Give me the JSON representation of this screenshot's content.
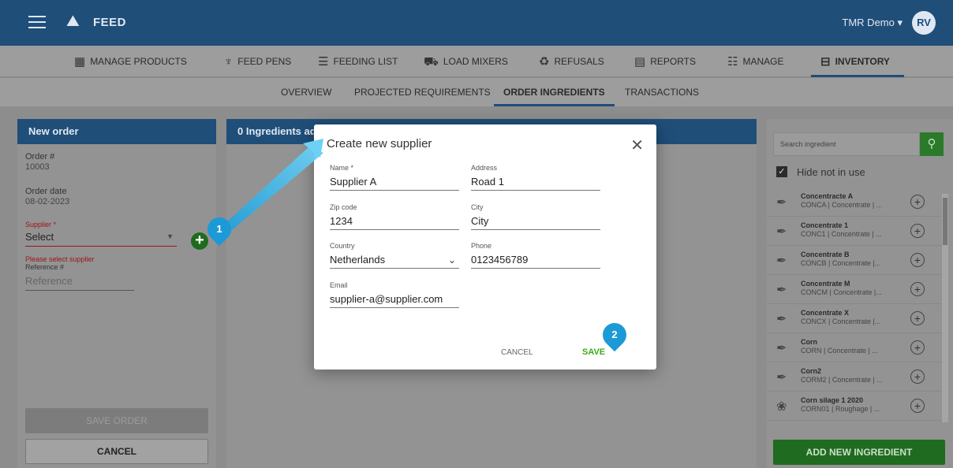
{
  "topbar": {
    "app_name": "FEED",
    "user_menu": "TMR Demo ▾",
    "avatar": "RV",
    "menu_icon": "hamburger-icon",
    "logo_icon": "cow-icon"
  },
  "modules": [
    {
      "label": "MANAGE PRODUCTS",
      "icon": "products-icon",
      "glyph": "▦"
    },
    {
      "label": "FEED PENS",
      "icon": "pen-icon",
      "glyph": "♆"
    },
    {
      "label": "FEEDING LIST",
      "icon": "list-icon",
      "glyph": "☰"
    },
    {
      "label": "LOAD MIXERS",
      "icon": "truck-icon",
      "glyph": "⛟"
    },
    {
      "label": "REFUSALS",
      "icon": "recycle-icon",
      "glyph": "♻"
    },
    {
      "label": "REPORTS",
      "icon": "reports-icon",
      "glyph": "▤"
    },
    {
      "label": "MANAGE",
      "icon": "manage-icon",
      "glyph": "☷"
    },
    {
      "label": "INVENTORY",
      "icon": "inventory-icon",
      "glyph": "⊟"
    }
  ],
  "tabs": [
    "OVERVIEW",
    "PROJECTED REQUIREMENTS",
    "ORDER INGREDIENTS",
    "TRANSACTIONS"
  ],
  "new_order": {
    "header": "New order",
    "order_label": "Order #",
    "order_value": "10003",
    "date_label": "Order date",
    "date_value": "08-02-2023",
    "supplier_label": "Supplier *",
    "supplier_value": "Select",
    "supplier_error": "Please select supplier",
    "reference_label": "Reference #",
    "reference_placeholder": "Reference",
    "save_label": "SAVE ORDER",
    "cancel_label": "CANCEL"
  },
  "middle": {
    "header": "0 Ingredients ad"
  },
  "dialog": {
    "title": "Create new supplier",
    "fields": {
      "name": {
        "label": "Name *",
        "value": "Supplier A"
      },
      "address": {
        "label": "Address",
        "value": "Road 1"
      },
      "zip": {
        "label": "Zip code",
        "value": "1234"
      },
      "city": {
        "label": "City",
        "value": "City"
      },
      "country": {
        "label": "Country",
        "value": "Netherlands"
      },
      "phone": {
        "label": "Phone",
        "value": "0123456789"
      },
      "email": {
        "label": "Email",
        "value": "supplier-a@supplier.com"
      }
    },
    "cancel_label": "CANCEL",
    "save_label": "SAVE"
  },
  "ingredients_panel": {
    "search_placeholder": "Search ingredient",
    "hide_label": "Hide not in use",
    "hide_checked": true,
    "add_label": "ADD NEW INGREDIENT",
    "items": [
      {
        "name": "Concentracte A",
        "sub": "CONCA | Concentrate | ...",
        "icon": "feather-icon"
      },
      {
        "name": "Concentrate 1",
        "sub": "CONC1 | Concentrate | ...",
        "icon": "feather-icon"
      },
      {
        "name": "Concentrate B",
        "sub": "CONCB | Concentrate |...",
        "icon": "feather-icon"
      },
      {
        "name": "Concentrate M",
        "sub": "CONCM | Concentrate |...",
        "icon": "feather-icon"
      },
      {
        "name": "Concentrate X",
        "sub": "CONCX | Concentrate |...",
        "icon": "feather-icon"
      },
      {
        "name": "Corn",
        "sub": "CORN | Concentrate | ...",
        "icon": "feather-icon"
      },
      {
        "name": "Corn2",
        "sub": "CORM2 | Concentrate | ...",
        "icon": "feather-icon"
      },
      {
        "name": "Corn silage 1 2020",
        "sub": "CORN01 | Roughage | ...",
        "icon": "corn-icon"
      }
    ]
  },
  "badges": [
    "1",
    "2"
  ],
  "colors": {
    "primary": "#1f4e79",
    "accent_green": "#3eaa1a",
    "badge": "#1c9ad6",
    "error": "#a01414"
  }
}
